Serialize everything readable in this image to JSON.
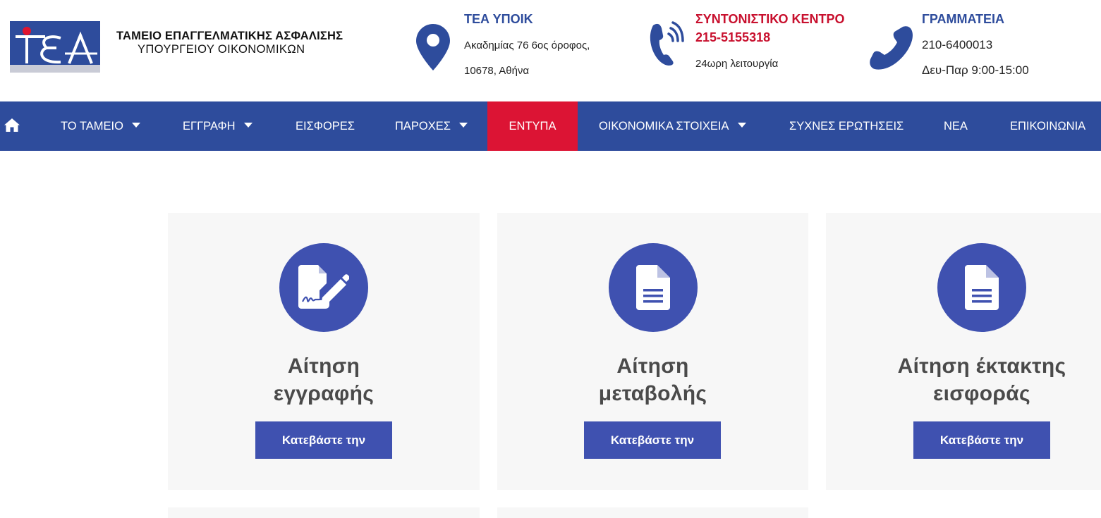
{
  "header": {
    "logo": {
      "mark_text": "ΤΕΑ",
      "line1": "ΤΑΜΕΙΟ ΕΠΑΓΓΕΛΜΑΤΙΚΗΣ ΑΣΦΑΛΙΣΗΣ",
      "line2": "ΥΠΟΥΡΓΕΙΟΥ ΟΙΚΟΝΟΜΙΚΩΝ"
    },
    "address": {
      "icon": "map-pin-icon",
      "title": "ΤΕΑ ΥΠΟΙΚ",
      "line1": "Ακαδημίας 76 6ος όροφος,",
      "line2": "10678, Αθήνα"
    },
    "call_center": {
      "icon": "phone-ringing-icon",
      "title": "ΣΥΝΤΟΝΙΣΤΙΚΟ ΚΕΝΤΡΟ",
      "phone": "215-5155318",
      "line1": "24ωρη λειτουργία"
    },
    "secretariat": {
      "icon": "phone-icon",
      "title": "ΓΡΑΜΜΑΤΕΙΑ",
      "phone": "210-6400013",
      "hours": "Δευ-Παρ 9:00-15:00"
    }
  },
  "nav": {
    "home_icon": "home-icon",
    "items": [
      {
        "label": "ΤΟ ΤΑΜΕΙΟ",
        "has_dropdown": true
      },
      {
        "label": "ΕΓΓΡΑΦΗ",
        "has_dropdown": true
      },
      {
        "label": "ΕΙΣΦΟΡΕΣ",
        "has_dropdown": false
      },
      {
        "label": "ΠΑΡΟΧΕΣ",
        "has_dropdown": true
      },
      {
        "label": "ΕΝΤΥΠΑ",
        "has_dropdown": false,
        "active": true
      },
      {
        "label": "ΟΙΚΟΝΟΜΙΚΑ ΣΤΟΙΧΕΙΑ",
        "has_dropdown": true
      },
      {
        "label": "ΣΥΧΝΕΣ ΕΡΩΤΗΣΕΙΣ",
        "has_dropdown": false
      },
      {
        "label": "ΝΕΑ",
        "has_dropdown": false
      },
      {
        "label": "ΕΠΙΚΟΙΝΩΝΙΑ",
        "has_dropdown": false
      }
    ]
  },
  "cards": [
    {
      "icon": "file-signature-icon",
      "title_line1": "Αίτηση",
      "title_line2": "εγγραφής",
      "button": "Κατεβάστε την"
    },
    {
      "icon": "file-alt-icon",
      "title_line1": "Αίτηση",
      "title_line2": "μεταβολής",
      "button": "Κατεβάστε την"
    },
    {
      "icon": "file-alt-icon",
      "title_line1": "Αίτηση έκτακτης",
      "title_line2": "εισφοράς",
      "button": "Κατεβάστε την"
    }
  ],
  "colors": {
    "nav_bg": "#2e4c9c",
    "nav_active": "#dc1434",
    "accent_blue": "#2e4c9c",
    "accent_red": "#c8102e",
    "card_button": "#3f51b0",
    "card_bg": "#f7f7f7"
  }
}
